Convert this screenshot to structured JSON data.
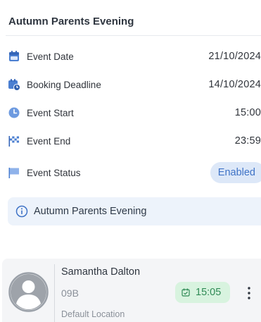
{
  "header": {
    "title": "Autumn Parents Evening"
  },
  "details": [
    {
      "icon": "calendar-icon",
      "label": "Event Date",
      "value": "21/10/2024"
    },
    {
      "icon": "calendar-clock-icon",
      "label": "Booking Deadline",
      "value": "14/10/2024"
    },
    {
      "icon": "clock-icon",
      "label": "Event Start",
      "value": "15:00"
    },
    {
      "icon": "checkered-flag-icon",
      "label": "Event End",
      "value": "23:59"
    },
    {
      "icon": "flag-icon",
      "label": "Event Status",
      "value": "Enabled"
    }
  ],
  "info": {
    "icon": "info-icon",
    "text": "Autumn Parents Evening"
  },
  "booking": {
    "name": "Samantha Dalton",
    "group": "09B",
    "location": "Default Location",
    "time": "15:05",
    "time_icon": "calendar-check-icon",
    "menu_icon": "more-vertical-icon"
  },
  "colors": {
    "accent": "#3f73c6",
    "badge_bg": "#dde8f8",
    "info_bg": "#edf3fb",
    "time_chip_bg": "#d8f3df",
    "time_chip_text": "#2f8a55"
  }
}
